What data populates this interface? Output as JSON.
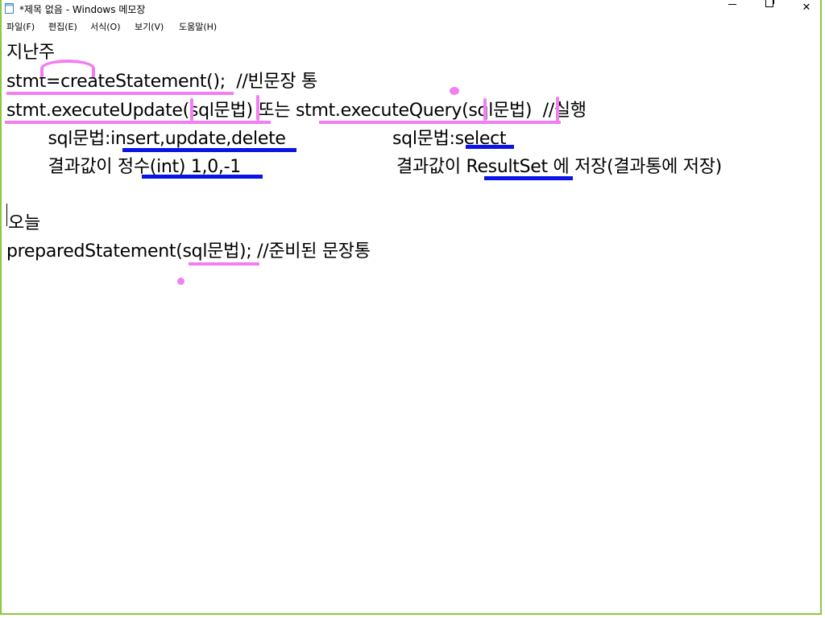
{
  "window": {
    "title": "*제목 없음 - Windows 메모장",
    "buttons": {
      "minimize": "—",
      "maximize": "☐",
      "close": "✕"
    }
  },
  "menu": {
    "items": [
      "파일(F)",
      "편집(E)",
      "서식(O)",
      "보기(V)",
      "도움말(H)"
    ]
  },
  "editor": {
    "lines": [
      "지난주",
      "stmt=createStatement();  //빈문장 통",
      "stmt.executeUpdate(sql문법) 또는 stmt.executeQuery(sql문법)  //실행",
      "     sql문법:insert,update,delete",
      "sql문법:select",
      "     결과값이 정수(int) 1,0,-1",
      "결과값이 ResultSet 에 저장(결과통에 저장)",
      "오늘",
      "preparedStatement(sql문법); //준비된 문장통"
    ]
  },
  "annotations": {
    "pink_color": "#f27ff2",
    "blue_color": "#0a14e6"
  }
}
